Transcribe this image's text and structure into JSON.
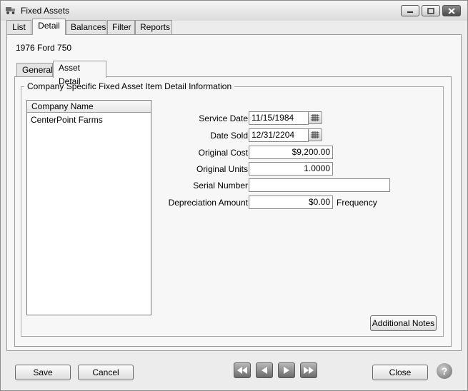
{
  "window": {
    "title": "Fixed Assets"
  },
  "tabs": [
    "List",
    "Detail",
    "Balances",
    "Filter",
    "Reports"
  ],
  "asset_title": "1976 Ford 750",
  "inner_tabs": [
    "General",
    "Asset Detail"
  ],
  "group_title": "Company Specific Fixed Asset Item Detail Information",
  "company_list": {
    "header": "Company Name",
    "items": [
      "CenterPoint Farms"
    ]
  },
  "fields": {
    "service_date": {
      "label": "Service Date",
      "value": "11/15/1984"
    },
    "date_sold": {
      "label": "Date Sold",
      "value": "12/31/2204"
    },
    "original_cost": {
      "label": "Original Cost",
      "value": "$9,200.00"
    },
    "original_units": {
      "label": "Original Units",
      "value": "1.0000"
    },
    "serial_number": {
      "label": "Serial Number",
      "value": ""
    },
    "depreciation_amount": {
      "label": "Depreciation Amount",
      "value": "$0.00",
      "suffix": "Frequency"
    }
  },
  "buttons": {
    "additional_notes": "Additional Notes",
    "save": "Save",
    "cancel": "Cancel",
    "close": "Close",
    "help": "?"
  },
  "icons": {
    "app": "truck-icon",
    "calendar": "calendar-icon",
    "nav": [
      "first-record-icon",
      "previous-record-icon",
      "next-record-icon",
      "last-record-icon"
    ]
  }
}
